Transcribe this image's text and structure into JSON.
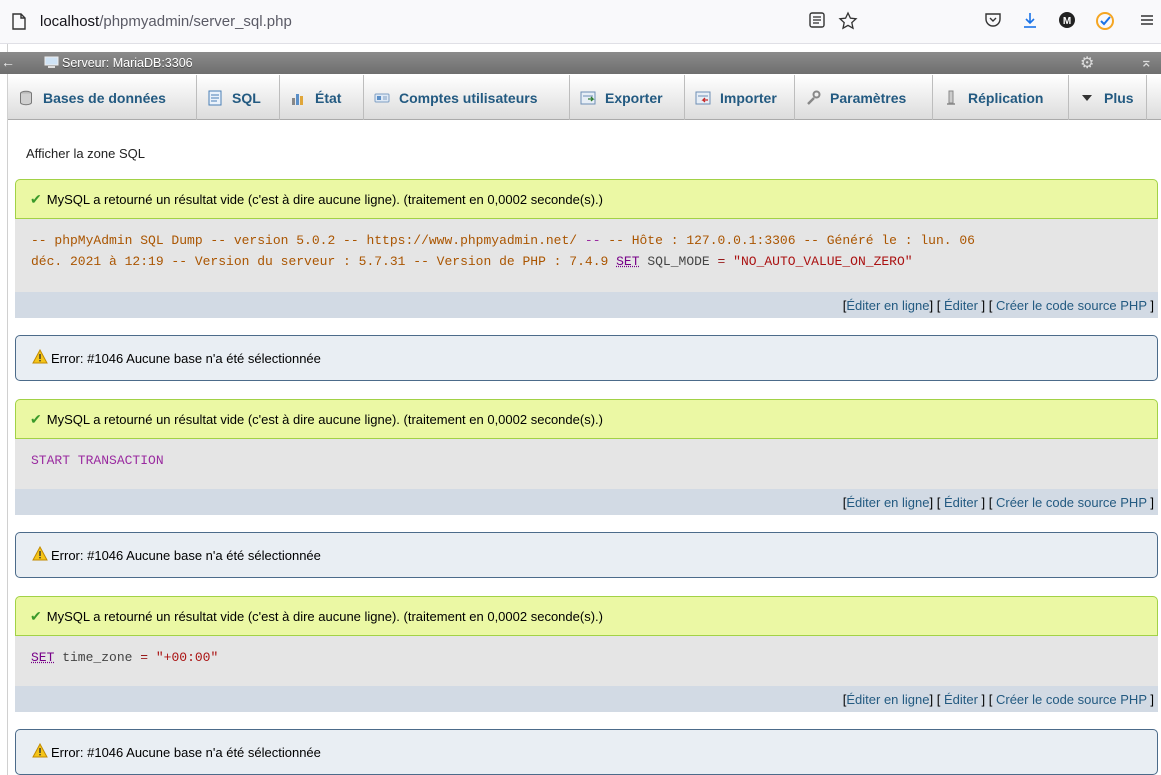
{
  "browser": {
    "url_host": "localhost",
    "url_path": "/phpmyadmin/server_sql.php"
  },
  "serverbar": {
    "label": "Serveur: MariaDB:3306"
  },
  "tabs": [
    {
      "label": "Bases de données",
      "icon": "database-icon"
    },
    {
      "label": "SQL",
      "icon": "sql-icon"
    },
    {
      "label": "État",
      "icon": "status-icon"
    },
    {
      "label": "Comptes utilisateurs",
      "icon": "users-icon"
    },
    {
      "label": "Exporter",
      "icon": "export-icon"
    },
    {
      "label": "Importer",
      "icon": "import-icon"
    },
    {
      "label": "Paramètres",
      "icon": "wrench-icon"
    },
    {
      "label": "Réplication",
      "icon": "replication-icon"
    },
    {
      "label": "Plus",
      "icon": "caret-down-icon"
    }
  ],
  "show_sql": "Afficher la zone SQL",
  "success_msg": "MySQL a retourné un résultat vide (c'est à dire aucune ligne). (traitement en 0,0002 seconde(s).)",
  "error_msg": "Error: #1046 Aucune base n'a été sélectionnée",
  "links": {
    "inline": "Éditer en ligne",
    "edit": "Éditer",
    "php": "Créer le code source PHP"
  },
  "sql": {
    "dump_1a": "-- phpMyAdmin SQL Dump -- version 5.0.2 -- https://www.phpmyadmin.net/ ",
    "dump_1b": "--",
    "dump_1c": " -- Hôte : 127.0.0.1:3306 -- Généré le : lun. 06",
    "dump_2a": "déc. 2021 à 12:19 -- Version du serveur : 5.7.31 -- Version de PHP : 7.4.9 ",
    "set": "SET",
    "dump_2b": " SQL_MODE ",
    "eq": "=",
    "dump_2c": " \"NO_AUTO_VALUE_ON_ZERO\"",
    "start_transaction": "START TRANSACTION",
    "time_zone": " time_zone ",
    "tz_value": "\"+00:00\""
  },
  "colors": {
    "link": "#235a81",
    "success_bg": "#ebf8a4",
    "error_border": "#4c6b8a",
    "sql_bg": "#e5e5e5"
  }
}
